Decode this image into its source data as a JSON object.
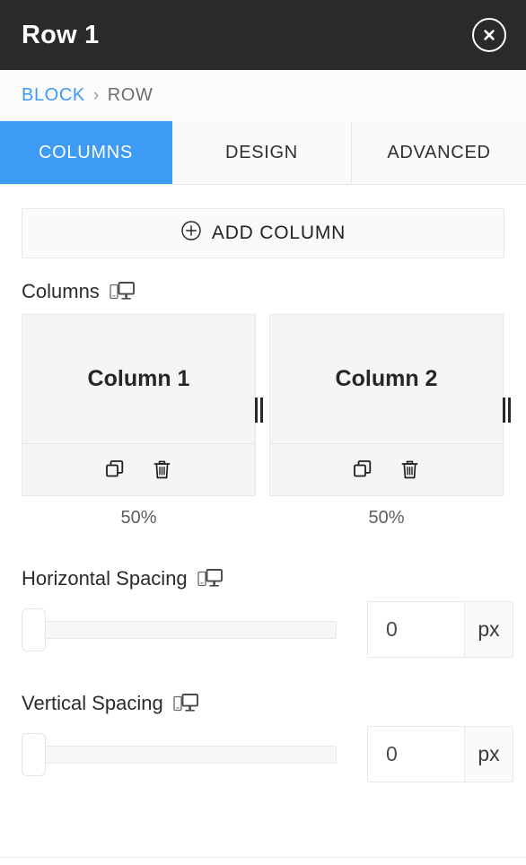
{
  "header": {
    "title": "Row 1",
    "close_icon": "close-circle-icon"
  },
  "breadcrumb": {
    "parent": "BLOCK",
    "separator": "›",
    "current": "ROW"
  },
  "tabs": [
    {
      "label": "COLUMNS",
      "active": true
    },
    {
      "label": "DESIGN",
      "active": false
    },
    {
      "label": "ADVANCED",
      "active": false
    }
  ],
  "actions": {
    "add_column_label": "ADD COLUMN",
    "add_column_icon": "plus-circle-icon"
  },
  "columns_section": {
    "label": "Columns",
    "responsive_icon": "responsive-device-icon",
    "items": [
      {
        "name": "Column 1",
        "width": "50%",
        "duplicate_icon": "duplicate-icon",
        "delete_icon": "trash-icon",
        "resize_handle_icon": "drag-handle-icon"
      },
      {
        "name": "Column 2",
        "width": "50%",
        "duplicate_icon": "duplicate-icon",
        "delete_icon": "trash-icon",
        "resize_handle_icon": "drag-handle-icon"
      }
    ]
  },
  "horizontal_spacing": {
    "label": "Horizontal Spacing",
    "responsive_icon": "responsive-device-icon",
    "value": "0",
    "unit": "px",
    "slider_value": 0,
    "slider_min": 0,
    "slider_max": 100
  },
  "vertical_spacing": {
    "label": "Vertical Spacing",
    "responsive_icon": "responsive-device-icon",
    "value": "0",
    "unit": "px",
    "slider_value": 0,
    "slider_min": 0,
    "slider_max": 100
  },
  "colors": {
    "header_bg": "#2a2a2d",
    "accent": "#3d9bf5",
    "card_bg": "#f5f5f5",
    "border": "#e8e8e8"
  }
}
